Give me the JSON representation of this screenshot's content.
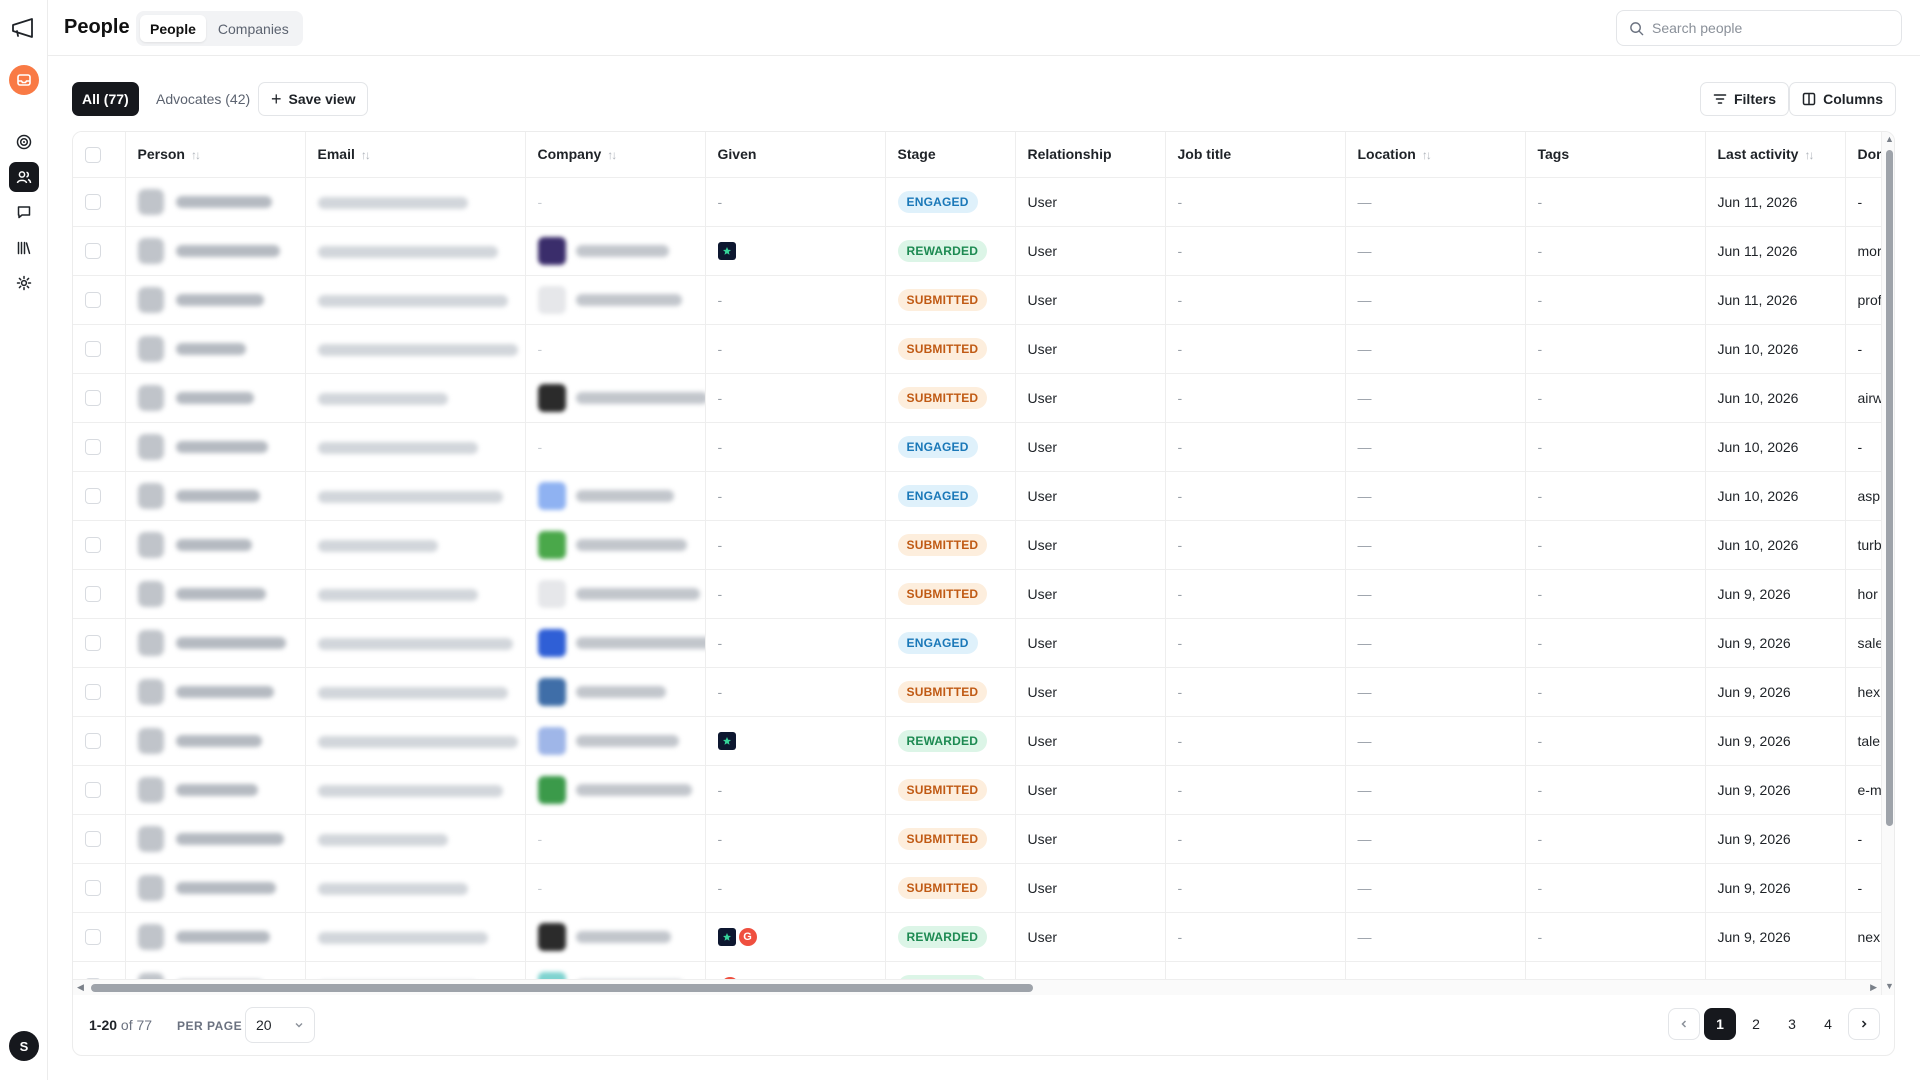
{
  "topbar": {
    "title": "People",
    "tabs": [
      {
        "label": "People",
        "active": true
      },
      {
        "label": "Companies",
        "active": false
      }
    ],
    "search_placeholder": "Search people"
  },
  "toolbar": {
    "all_label": "All (77)",
    "advocates_label": "Advocates (42)",
    "save_view_label": "Save view",
    "filters_label": "Filters",
    "columns_label": "Columns"
  },
  "sidebar": {
    "avatar_initial": "S",
    "icons": [
      "target-icon",
      "users-icon",
      "chat-icon",
      "library-icon",
      "gear-icon"
    ],
    "active_icon": "users-icon"
  },
  "table": {
    "columns": [
      "Person",
      "Email",
      "Company",
      "Given",
      "Stage",
      "Relationship",
      "Job title",
      "Location",
      "Tags",
      "Last activity",
      "Domain"
    ],
    "rows": [
      {
        "given": "-",
        "stage": "ENGAGED",
        "relationship": "User",
        "job_title": "-",
        "location": "—",
        "tags": "-",
        "last_activity": "Jun 11, 2026",
        "domain": "-",
        "co": "",
        "given_icons": []
      },
      {
        "given": "",
        "stage": "REWARDED",
        "relationship": "User",
        "job_title": "-",
        "location": "—",
        "tags": "-",
        "last_activity": "Jun 11, 2026",
        "domain": "mor",
        "co": "#3a2d6b",
        "given_icons": [
          "star"
        ]
      },
      {
        "given": "-",
        "stage": "SUBMITTED",
        "relationship": "User",
        "job_title": "-",
        "location": "—",
        "tags": "-",
        "last_activity": "Jun 11, 2026",
        "domain": "prof",
        "co": "#e6e7ea",
        "given_icons": []
      },
      {
        "given": "-",
        "stage": "SUBMITTED",
        "relationship": "User",
        "job_title": "-",
        "location": "—",
        "tags": "-",
        "last_activity": "Jun 10, 2026",
        "domain": "-",
        "co": "",
        "given_icons": []
      },
      {
        "given": "-",
        "stage": "SUBMITTED",
        "relationship": "User",
        "job_title": "-",
        "location": "—",
        "tags": "-",
        "last_activity": "Jun 10, 2026",
        "domain": "airw",
        "co": "#2b2b2b",
        "given_icons": []
      },
      {
        "given": "-",
        "stage": "ENGAGED",
        "relationship": "User",
        "job_title": "-",
        "location": "—",
        "tags": "-",
        "last_activity": "Jun 10, 2026",
        "domain": "-",
        "co": "",
        "given_icons": []
      },
      {
        "given": "-",
        "stage": "ENGAGED",
        "relationship": "User",
        "job_title": "-",
        "location": "—",
        "tags": "-",
        "last_activity": "Jun 10, 2026",
        "domain": "aspi",
        "co": "#8fb2f2",
        "given_icons": []
      },
      {
        "given": "-",
        "stage": "SUBMITTED",
        "relationship": "User",
        "job_title": "-",
        "location": "—",
        "tags": "-",
        "last_activity": "Jun 10, 2026",
        "domain": "turb",
        "co": "#4aa84a",
        "given_icons": []
      },
      {
        "given": "-",
        "stage": "SUBMITTED",
        "relationship": "User",
        "job_title": "-",
        "location": "—",
        "tags": "-",
        "last_activity": "Jun 9, 2026",
        "domain": "hor",
        "co": "#e6e7ea",
        "given_icons": []
      },
      {
        "given": "-",
        "stage": "ENGAGED",
        "relationship": "User",
        "job_title": "-",
        "location": "—",
        "tags": "-",
        "last_activity": "Jun 9, 2026",
        "domain": "sale",
        "co": "#2f5fd6",
        "given_icons": []
      },
      {
        "given": "-",
        "stage": "SUBMITTED",
        "relationship": "User",
        "job_title": "-",
        "location": "—",
        "tags": "-",
        "last_activity": "Jun 9, 2026",
        "domain": "hex",
        "co": "#3f6ea8",
        "given_icons": []
      },
      {
        "given": "",
        "stage": "REWARDED",
        "relationship": "User",
        "job_title": "-",
        "location": "—",
        "tags": "-",
        "last_activity": "Jun 9, 2026",
        "domain": "tale",
        "co": "#9fb6e8",
        "given_icons": [
          "star"
        ]
      },
      {
        "given": "-",
        "stage": "SUBMITTED",
        "relationship": "User",
        "job_title": "-",
        "location": "—",
        "tags": "-",
        "last_activity": "Jun 9, 2026",
        "domain": "e-m",
        "co": "#3b9a4a",
        "given_icons": []
      },
      {
        "given": "-",
        "stage": "SUBMITTED",
        "relationship": "User",
        "job_title": "-",
        "location": "—",
        "tags": "-",
        "last_activity": "Jun 9, 2026",
        "domain": "-",
        "co": "",
        "given_icons": []
      },
      {
        "given": "-",
        "stage": "SUBMITTED",
        "relationship": "User",
        "job_title": "-",
        "location": "—",
        "tags": "-",
        "last_activity": "Jun 9, 2026",
        "domain": "-",
        "co": "",
        "given_icons": []
      },
      {
        "given": "",
        "stage": "REWARDED",
        "relationship": "User",
        "job_title": "-",
        "location": "—",
        "tags": "-",
        "last_activity": "Jun 9, 2026",
        "domain": "nex",
        "co": "#2b2b2b",
        "given_icons": [
          "star",
          "g2"
        ]
      },
      {
        "given": "",
        "stage": "REWARDED",
        "relationship": "U",
        "job_title": "",
        "location": "",
        "tags": "",
        "last_activity": "",
        "domain": "",
        "co": "#7fd3d0",
        "given_icons": [
          "g2"
        ]
      }
    ]
  },
  "footer": {
    "range": "1-20",
    "of_label": "of 77",
    "per_page_label": "PER PAGE",
    "per_page_value": "20",
    "pages": [
      "1",
      "2",
      "3",
      "4"
    ],
    "current_page": "1"
  },
  "colors": {
    "accent_dark": "#16181d",
    "org_avatar": "#f97a45",
    "engaged_bg": "#dff1fb",
    "rewarded_bg": "#dcf5e7",
    "submitted_bg": "#fdeedd"
  }
}
